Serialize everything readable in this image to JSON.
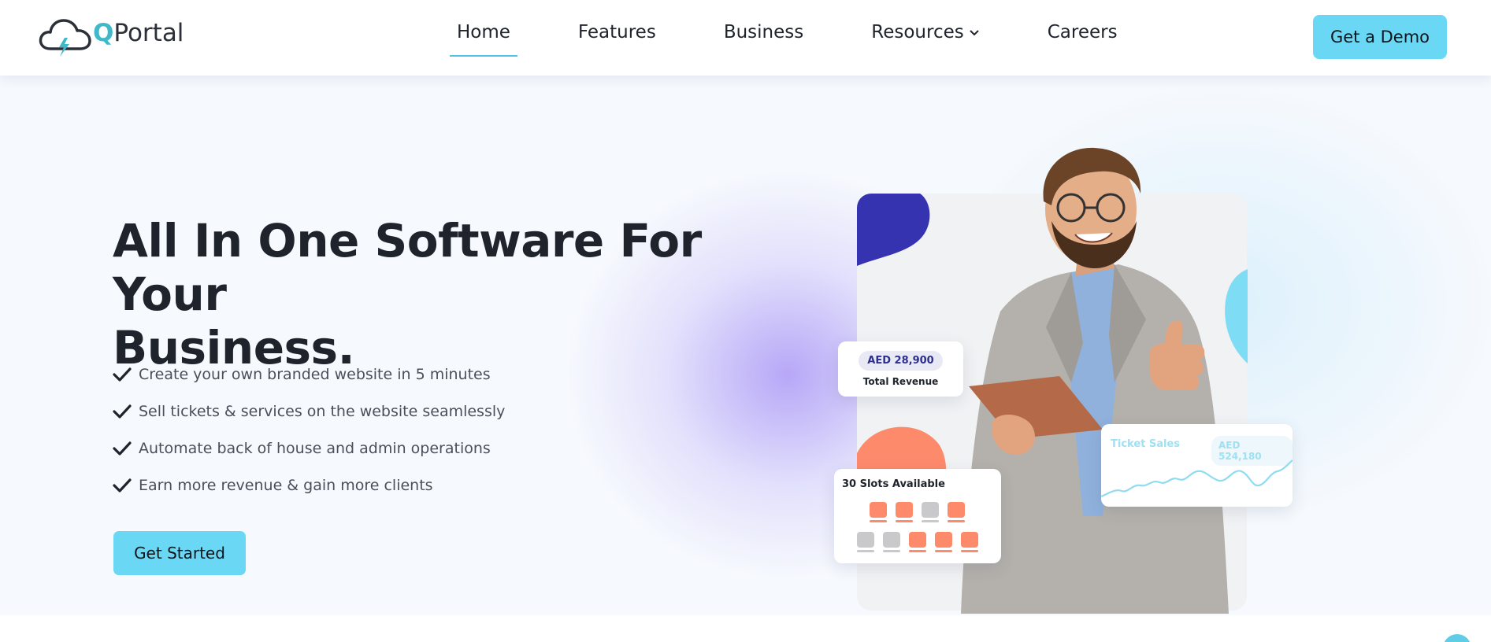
{
  "header": {
    "logo": {
      "q": "Q",
      "text": "Portal",
      "icon": "cloud-lightning-icon"
    },
    "nav": [
      {
        "label": "Home",
        "active": true
      },
      {
        "label": "Features"
      },
      {
        "label": "Business"
      },
      {
        "label": "Resources",
        "has_dropdown": true
      },
      {
        "label": "Careers"
      }
    ],
    "demo_label": "Get a Demo"
  },
  "hero": {
    "headline_line1": "All In One Software For Your",
    "headline_line2": "Business.",
    "features": [
      "Create your own branded website in 5 minutes",
      "Sell tickets & services on the website seamlessly",
      "Automate back of house and admin operations",
      "Earn more revenue & gain more clients"
    ],
    "cta_label": "Get Started"
  },
  "cards": {
    "revenue": {
      "value": "AED 28,900",
      "label": "Total Revenue"
    },
    "slots": {
      "title": "30 Slots Available",
      "seat_rows": [
        [
          "available",
          "available",
          "taken",
          "available"
        ],
        [
          "taken",
          "taken",
          "available",
          "available",
          "available"
        ]
      ]
    },
    "sales": {
      "title": "Ticket Sales",
      "value": "AED 524,180"
    }
  },
  "colors": {
    "accent": "#6ad8f5",
    "brand_teal": "#3fb9c8",
    "blob_blue": "#3633b0",
    "blob_orange": "#fd8a6b",
    "seat_available": "#fd8a6b",
    "seat_taken": "#c9c9cc"
  }
}
